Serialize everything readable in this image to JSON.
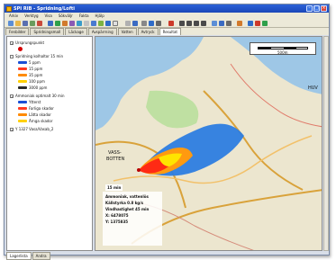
{
  "window": {
    "title": "SPI RIB - Spridning/Lofti"
  },
  "menu": [
    "Arkiv",
    "Verktyg",
    "Visa",
    "Sökväljr",
    "Fakta",
    "Hjälp"
  ],
  "tabs": [
    "Fenbilder",
    "Spridningsmall",
    "Läckage",
    "Avspärrning",
    "Vatten",
    "Avtryck",
    "Resultat"
  ],
  "active_tab": "Resultat",
  "layers": [
    {
      "label": "Ursprungspunkt",
      "checked": true,
      "level": 0
    },
    {
      "label": "Spridning kolhaltor 15 min",
      "checked": false,
      "level": 0
    },
    {
      "label": "5 ppm",
      "level": 1,
      "color": "#1a4fd6"
    },
    {
      "label": "15 ppm",
      "level": 1,
      "color": "#ff3a22"
    },
    {
      "label": "35 ppm",
      "level": 1,
      "color": "#ff8a00"
    },
    {
      "label": "100 ppm",
      "level": 1,
      "color": "#ffd000"
    },
    {
      "label": "3000 ppm",
      "level": 1,
      "color": "#2a2a2a"
    },
    {
      "label": "Ammoniak optimalt 30 min",
      "checked": true,
      "level": 0
    },
    {
      "label": "Ytterst",
      "level": 1,
      "color": "#1a4fd6"
    },
    {
      "label": "Farliga skador",
      "level": 1,
      "color": "#ff3a22"
    },
    {
      "label": "Lätta skador",
      "level": 1,
      "color": "#ff8a00"
    },
    {
      "label": "Ärnga skador",
      "level": 1,
      "color": "#ffd000"
    },
    {
      "label": "Y 1327 Vasa/Vasab_2",
      "checked": true,
      "level": 0
    }
  ],
  "bottom_tabs": [
    "Lagerlista",
    "Andra"
  ],
  "map": {
    "scale_label": "500m",
    "labels": [
      "VASS-",
      "BOTTEN",
      "HUV"
    ],
    "info_chip": "15 min",
    "info_lines": [
      "Ammoniak, vattenlös",
      "Källstyrka 0.8 kg/s",
      "Vindhastighet 45 min",
      "X: 6478075",
      "Y: 1375835"
    ]
  },
  "colors": {
    "water": "#9ec7e6",
    "land": "#ece6cf",
    "road": "#d9a23a",
    "park": "#bfe0a2",
    "plume_blue": "#2d7de0",
    "plume_red": "#ff2a14",
    "plume_orange": "#ff9a10",
    "plume_yellow": "#ffe400"
  }
}
